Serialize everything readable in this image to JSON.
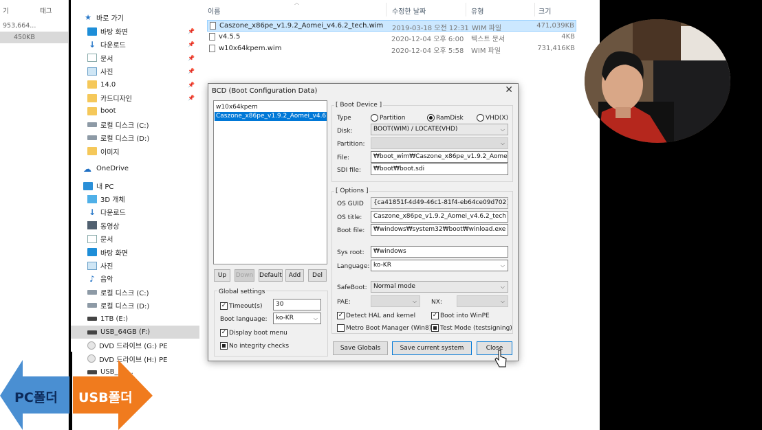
{
  "explorer": {
    "left_strip": {
      "col_fragment": "기",
      "col_tag": "태그",
      "cell_1": "953,664...",
      "cell_2": "450KB"
    },
    "nav": {
      "quick_access": "바로 가기",
      "items": [
        {
          "label": "바탕 화면",
          "icon": "desktop-icon",
          "pinned": true
        },
        {
          "label": "다운로드",
          "icon": "download-icon",
          "pinned": true
        },
        {
          "label": "문서",
          "icon": "document-icon",
          "pinned": true
        },
        {
          "label": "사진",
          "icon": "pictures-icon",
          "pinned": true
        },
        {
          "label": "14.0",
          "icon": "folder-icon",
          "pinned": true
        },
        {
          "label": "카드디자인",
          "icon": "folder-icon",
          "pinned": true
        },
        {
          "label": "boot",
          "icon": "folder-icon",
          "pinned": false
        },
        {
          "label": "로컬 디스크 (C:)",
          "icon": "drive-icon",
          "pinned": false
        },
        {
          "label": "로컬 디스크 (D:)",
          "icon": "drive-icon",
          "pinned": false
        },
        {
          "label": "이미지",
          "icon": "folder-icon",
          "pinned": false
        }
      ],
      "onedrive": "OneDrive",
      "this_pc": "내 PC",
      "pc_items": [
        {
          "label": "3D 개체",
          "icon": "3d-objects-icon"
        },
        {
          "label": "다운로드",
          "icon": "download-icon"
        },
        {
          "label": "동영상",
          "icon": "video-icon"
        },
        {
          "label": "문서",
          "icon": "document-icon"
        },
        {
          "label": "바탕 화면",
          "icon": "desktop-icon"
        },
        {
          "label": "사진",
          "icon": "pictures-icon"
        },
        {
          "label": "음악",
          "icon": "music-icon"
        },
        {
          "label": "로컬 디스크 (C:)",
          "icon": "drive-icon"
        },
        {
          "label": "로컬 디스크 (D:)",
          "icon": "drive-icon"
        },
        {
          "label": "1TB (E:)",
          "icon": "usb-drive-icon"
        },
        {
          "label": "USB_64GB (F:)",
          "icon": "usb-drive-icon",
          "selected": true
        },
        {
          "label": "DVD 드라이브 (G:) PE",
          "icon": "dvd-icon"
        },
        {
          "label": "DVD 드라이브 (H:) PE",
          "icon": "dvd-icon"
        },
        {
          "label": "USB_64...",
          "icon": "usb-drive-icon"
        }
      ]
    },
    "columns": {
      "name": "이름",
      "date": "수정한 날짜",
      "type": "유형",
      "size": "크기"
    },
    "files": [
      {
        "name": "Caszone_x86pe_v1.9.2_Aomei_v4.6.2_tech.wim",
        "date": "2019-03-18 오전 12:31",
        "type": "WIM 파일",
        "size": "471,039KB",
        "selected": true
      },
      {
        "name": "v4.5.5",
        "date": "2020-12-04 오후 6:00",
        "type": "텍스트 문서",
        "size": "4KB"
      },
      {
        "name": "w10x64kpem.wim",
        "date": "2020-12-04 오후 5:58",
        "type": "WIM 파일",
        "size": "731,416KB"
      }
    ]
  },
  "dialog": {
    "title": "BCD (Boot Configuration Data)",
    "close": "✕",
    "entries": [
      "w10x64kpem",
      "Caszone_x86pe_v1.9.2_Aomei_v4.6.2_tech"
    ],
    "list_buttons": {
      "up": "Up",
      "down": "Down",
      "default": "Default",
      "add": "Add",
      "del": "Del"
    },
    "global": {
      "title": "Global settings",
      "timeout_label": "Timeout(s)",
      "timeout_value": "30",
      "boot_language_label": "Boot language:",
      "boot_language_value": "ko-KR",
      "display_boot_menu": "Display boot menu",
      "no_integrity_checks": "No integrity checks"
    },
    "boot_device": {
      "title": "[ Boot Device ]",
      "type_label": "Type",
      "partition_opt": "Partition",
      "ramdisk_opt": "RamDisk",
      "vhd_opt": "VHD(X)",
      "disk_label": "Disk:",
      "disk_value": "BOOT(WIM) / LOCATE(VHD)",
      "partition_label": "Partition:",
      "file_label": "File:",
      "file_value": "₩boot_wim₩Caszone_x86pe_v1.9.2_Aomei_v4.6.2_tech.wim",
      "sdi_label": "SDI file:",
      "sdi_value": "₩boot₩boot.sdi"
    },
    "options": {
      "title": "[ Options ]",
      "guid_label": "OS GUID",
      "guid_value": "{ca41851f-4d49-46c1-81f4-eb64ce09d702}",
      "os_title_label": "OS title:",
      "os_title_value": "Caszone_x86pe_v1.9.2_Aomei_v4.6.2_tech",
      "boot_file_label": "Boot file:",
      "boot_file_value": "₩windows₩system32₩boot₩winload.exe",
      "sysroot_label": "Sys root:",
      "sysroot_value": "₩windows",
      "language_label": "Language:",
      "language_value": "ko-KR",
      "safeboot_label": "SafeBoot:",
      "safeboot_value": "Normal mode",
      "pae_label": "PAE:",
      "nx_label": "NX:",
      "detect_hal": "Detect HAL and kernel",
      "boot_winpe": "Boot into WinPE",
      "metro_boot": "Metro Boot Manager (Win8)",
      "test_mode": "Test Mode (testsigning)"
    },
    "buttons": {
      "save_globals": "Save Globals",
      "save_current": "Save current system",
      "close": "Close"
    }
  },
  "overlay": {
    "pc_arrow": "PC폴더",
    "usb_arrow": "USB폴더",
    "pc_arrow_color": "#4a8fd2",
    "usb_arrow_color": "#f07b1e"
  }
}
